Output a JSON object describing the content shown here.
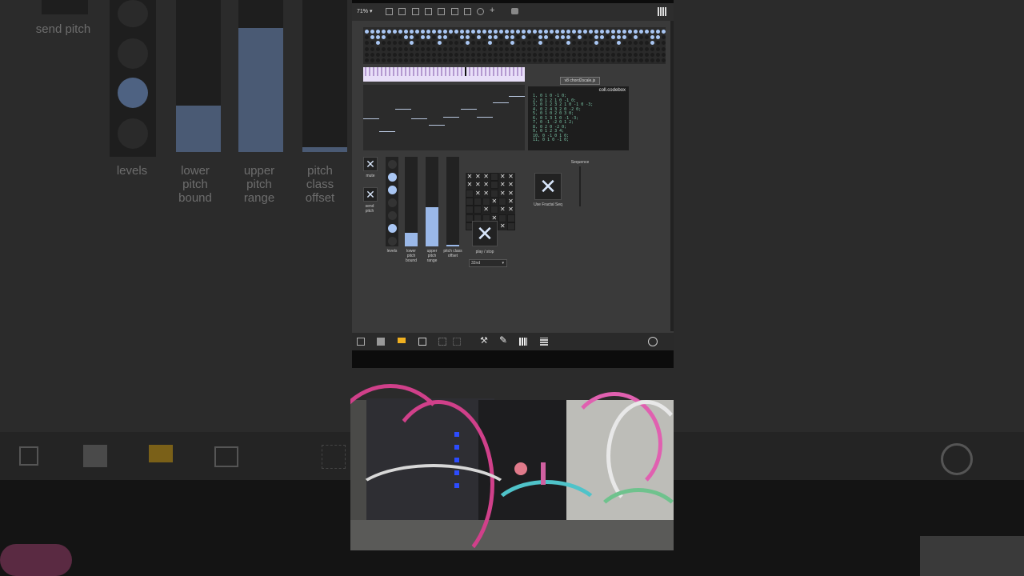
{
  "app": {
    "zoom": "71% ▾",
    "toolbar_icons": [
      "new-patch-icon",
      "presentation-icon",
      "comment-icon",
      "message-icon",
      "object-icon",
      "number-icon",
      "bang-icon",
      "clock-icon",
      "plus-icon",
      "bucket-icon",
      "grid-icon"
    ],
    "bottombar_icons": [
      "edit-icon",
      "inspector-icon",
      "presentation-icon",
      "windows-icon",
      "grid-icon",
      "snap-icon",
      "wrench-icon",
      "keyboard-icon",
      "qwerty-icon",
      "pause-icon"
    ]
  },
  "codebox": {
    "js_label": "v8 chord2scale.js",
    "title": "coll.codebox",
    "lines": [
      "1, 0 1 0 -1 0;",
      "2, 0 1 2 1 0 -1 0;",
      "3, 0 1 2 3 2 1 0 -1 0 -3;",
      "4, 0 2 4 3 2 0 -2 0;",
      "5, 0 1 0 2 0 3 0;",
      "6, 0 1 3 1 0 -1 -3;",
      "7, 0 -1 -2 0 1 2;",
      "8, 0 2 0 -2 0;",
      "9, 0 1 2 3 4;",
      "10, 0 -1 0 1 0;",
      "11, 0 1 0 -1 0;"
    ]
  },
  "controls": {
    "mute_label": "mute",
    "send_pitch_label": "send pitch",
    "levels_label": "levels",
    "lower_pitch_label": "lower pitch bound",
    "upper_pitch_label": "upper pitch range",
    "pitch_class_label": "pitch class offset",
    "play_stop_label": "play / stop",
    "fractal_label": "Use Fractal Seq",
    "sequence_label": "Sequence",
    "rate_value": "32nd",
    "lower_pitch_level": 0.15,
    "upper_pitch_level": 0.44,
    "pitch_class_level": 0.02
  },
  "background": {
    "send_pitch": "send pitch",
    "levels": "levels",
    "lower_pitch_bound": "lower pitch bound",
    "upper_pitch_range": "upper pitch range",
    "pitch_class_offset": "pitch class offset"
  },
  "colors": {
    "accent": "#a9c6f3",
    "panel": "#3a3a3a",
    "piano": "#e8dff8",
    "code": "#79c3a6",
    "presentation": "#f0b020"
  }
}
